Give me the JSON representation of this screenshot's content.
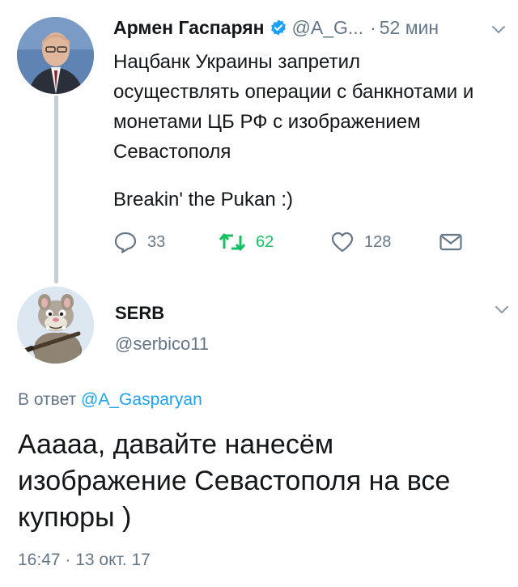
{
  "tweet1": {
    "name": "Армен Гаспарян",
    "handle": "@A_G...",
    "dot": "·",
    "time": "52 мин",
    "text": "Нацбанк Украины запретил осуществлять операции с банкнотами и монетами ЦБ РФ с изображением Севастополя",
    "text2": "Breakin' the Pukan :)",
    "replies": "33",
    "retweets": "62",
    "likes": "128"
  },
  "tweet2": {
    "name": "SERB",
    "handle": "@serbico11",
    "reply_prefix": "В ответ",
    "reply_handle": "@A_Gasparyan",
    "text": "Ааааа, давайте нанесём изображение Севастополя на все купюры )",
    "meta": "16:47 · 13 окт. 17"
  },
  "colors": {
    "accent": "#1da1f2",
    "muted": "#657786",
    "retweet": "#17bf63",
    "thread_line": "#c4cfd6"
  }
}
